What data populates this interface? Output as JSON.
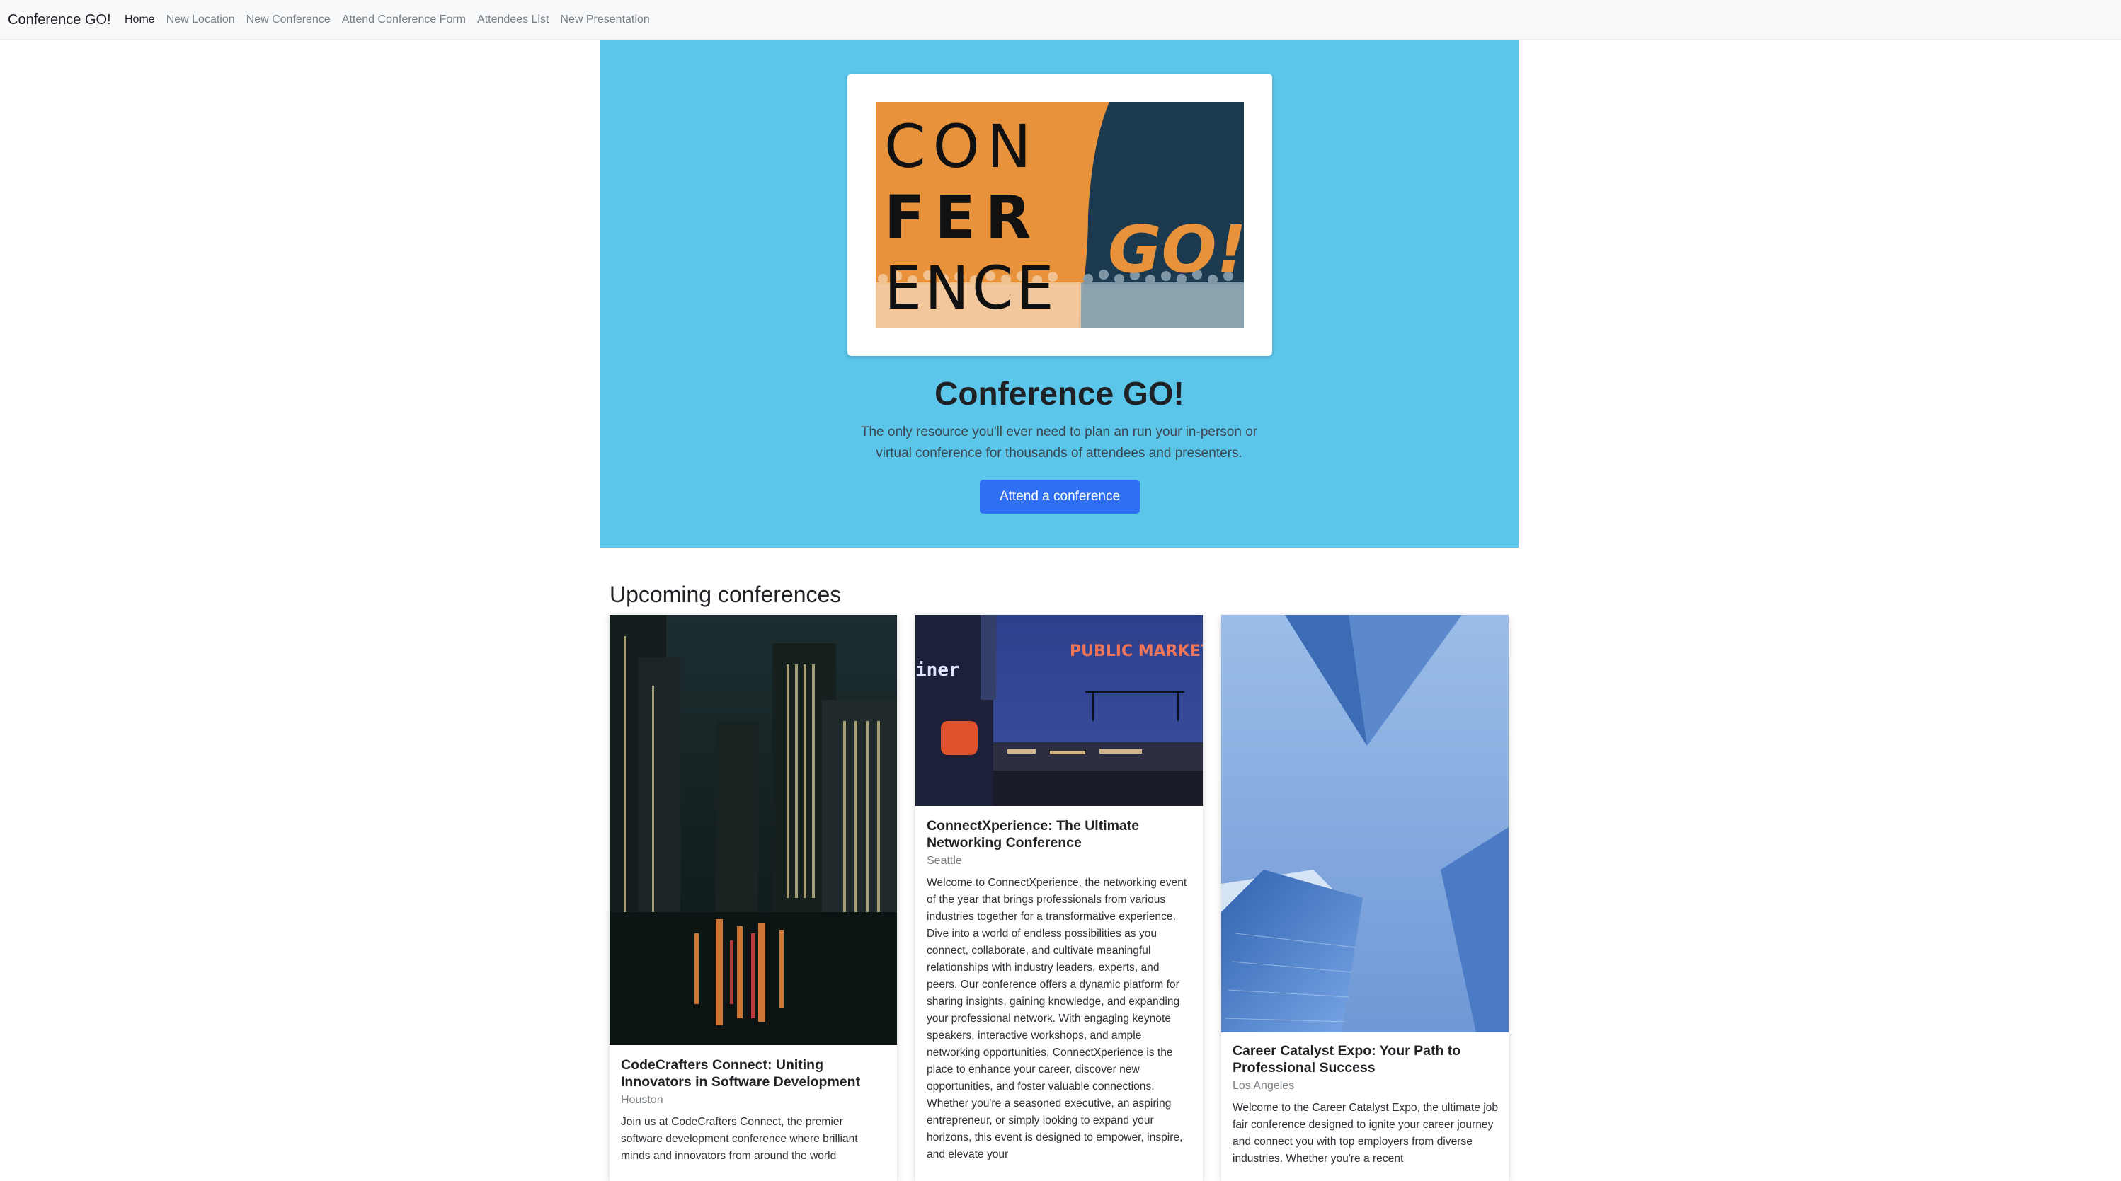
{
  "navbar": {
    "brand": "Conference GO!",
    "links": [
      {
        "label": "Home",
        "active": true
      },
      {
        "label": "New Location",
        "active": false
      },
      {
        "label": "New Conference",
        "active": false
      },
      {
        "label": "Attend Conference Form",
        "active": false
      },
      {
        "label": "Attendees List",
        "active": false
      },
      {
        "label": "New Presentation",
        "active": false
      }
    ]
  },
  "hero": {
    "logo": {
      "line1": "CON",
      "line2": "FER",
      "line3": "ENCE",
      "go": "GO!"
    },
    "title": "Conference GO!",
    "lead": "The only resource you'll ever need to plan an run your in-person or virtual conference for thousands of attendees and presenters.",
    "button": "Attend a conference",
    "colors": {
      "background": "#5bc6ea",
      "button": "#2f6ff4",
      "logo_orange": "#e8923b",
      "logo_navy": "#1c3a4f"
    }
  },
  "upcoming": {
    "title": "Upcoming conferences",
    "cards": [
      {
        "image": "city-street-night-photo",
        "name": "CodeCrafters Connect: Uniting Innovators in Software Development",
        "location": "Houston",
        "description": "Join us at CodeCrafters Connect, the premier software development conference where brilliant minds and innovators from around the world"
      },
      {
        "image": "public-market-night-photo",
        "image_sign": "PUBLIC MARKET",
        "image_side_text": "iner",
        "name": "ConnectXperience: The Ultimate Networking Conference",
        "location": "Seattle",
        "description": "Welcome to ConnectXperience, the networking event of the year that brings professionals from various industries together for a transformative experience. Dive into a world of endless possibilities as you connect, collaborate, and cultivate meaningful relationships with industry leaders, experts, and peers. Our conference offers a dynamic platform for sharing insights, gaining knowledge, and expanding your professional network. With engaging keynote speakers, interactive workshops, and ample networking opportunities, ConnectXperience is the place to enhance your career, discover new opportunities, and foster valuable connections. Whether you're a seasoned executive, an aspiring entrepreneur, or simply looking to expand your horizons, this event is designed to empower, inspire, and elevate your"
      },
      {
        "image": "skyscrapers-sky-photo",
        "name": "Career Catalyst Expo: Your Path to Professional Success",
        "location": "Los Angeles",
        "description": "Welcome to the Career Catalyst Expo, the ultimate job fair conference designed to ignite your career journey and connect you with top employers from diverse industries. Whether you're a recent"
      }
    ]
  }
}
